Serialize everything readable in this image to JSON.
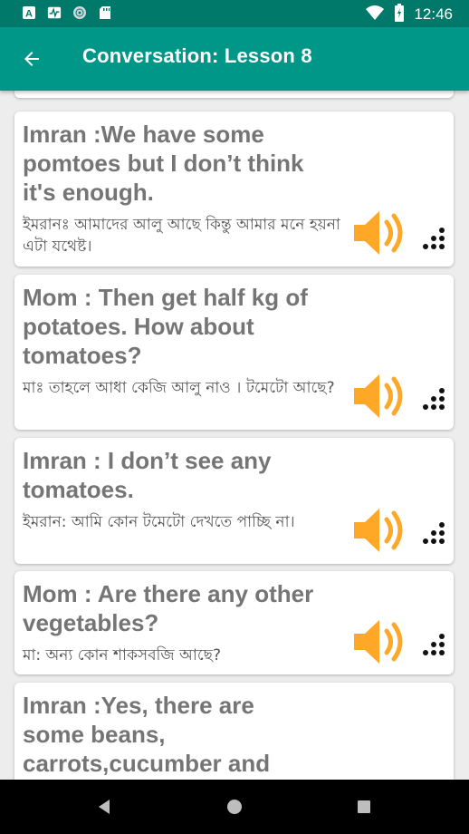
{
  "status_bar": {
    "time": "12:46",
    "left_icons": [
      "a-icon",
      "pulse-icon",
      "globe-icon",
      "sd-card-icon"
    ],
    "right_icons": [
      "wifi-icon",
      "battery-icon"
    ]
  },
  "app_bar": {
    "title": "Conversation: Lesson 8",
    "back_icon": "arrow-left-icon",
    "background": "#009688"
  },
  "accent_color": "#FFA726",
  "cards": [
    {
      "english": "Imran :We have some pomtoes but I don’t think it's enough.",
      "bangla": "ইমরানঃ আমাদের আলু আছে কিন্তু আমার মনে হয়না এটা যথেষ্ট।"
    },
    {
      "english": "Mom : Then get half kg of potatoes. How about tomatoes?",
      "bangla": "মাঃ তাহলে আধা কেজি আলু নাও । টমেটো আছে?"
    },
    {
      "english": "Imran : I don’t see any tomatoes.",
      "bangla": "ইমরান: আমি কোন টমেটো দেখতে পাচ্ছি না।"
    },
    {
      "english": "Mom : Are there any other vegetables?",
      "bangla": "মা: অন্য কোন শাকসবজি আছে?"
    },
    {
      "english": "Imran :Yes, there are some beans, carrots,cucumber and eggplants. . . .That’s",
      "bangla": ""
    }
  ],
  "nav_bar": {
    "buttons": [
      "back-triangle",
      "home-circle",
      "recents-square"
    ]
  }
}
